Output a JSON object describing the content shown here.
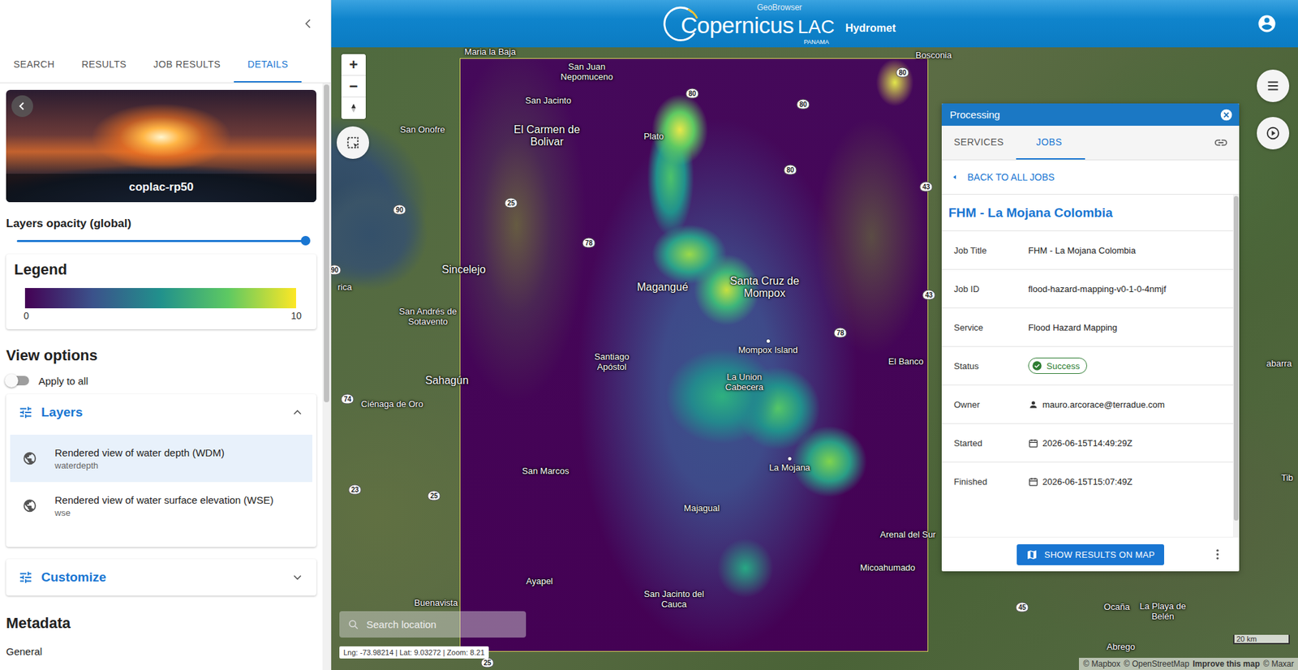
{
  "sidebar": {
    "tabs": [
      {
        "label": "SEARCH",
        "selected": false
      },
      {
        "label": "RESULTS",
        "selected": false
      },
      {
        "label": "JOB RESULTS",
        "selected": false
      },
      {
        "label": "DETAILS",
        "selected": true
      }
    ],
    "collection": {
      "title": "coplac-rp50"
    },
    "opacity": {
      "label": "Layers opacity (global)",
      "level": 1
    },
    "legend": {
      "title": "Legend",
      "min": "0",
      "max": "10"
    },
    "view_options": {
      "title": "View options",
      "apply_to_all": {
        "label": "Apply to all",
        "on": false
      }
    },
    "layers": {
      "title": "Layers",
      "expanded": true,
      "items": [
        {
          "title": "Rendered view of water depth (WDM)",
          "subtitle": "waterdepth",
          "selected": true
        },
        {
          "title": "Rendered view of water surface elevation (WSE)",
          "subtitle": "wse",
          "selected": false
        }
      ]
    },
    "customize": {
      "title": "Customize",
      "expanded": false
    },
    "metadata": {
      "title": "Metadata",
      "section": "General"
    }
  },
  "header": {
    "brand_top": "GeoBrowser",
    "brand": "Copernicus",
    "brand_suffix": "LAC",
    "brand_sub": "PANAMA",
    "app": "Hydromet"
  },
  "map": {
    "zoom_in": "+",
    "zoom_out": "−",
    "places": [
      {
        "name": "Maria la Baja",
        "kind": "town"
      },
      {
        "name": "San Juan Nepomuceno",
        "kind": "town"
      },
      {
        "name": "Bosconia",
        "kind": "town"
      },
      {
        "name": "San Jacinto",
        "kind": "town"
      },
      {
        "name": "Plato",
        "kind": "town"
      },
      {
        "name": "El Carmen de Bolivar",
        "kind": "city"
      },
      {
        "name": "San Onofre",
        "kind": "town"
      },
      {
        "name": "Sincelejo",
        "kind": "city"
      },
      {
        "name": "Magangué",
        "kind": "city"
      },
      {
        "name": "Santa Cruz de Mompox",
        "kind": "city"
      },
      {
        "name": "San Andrés de Sotavento",
        "kind": "town"
      },
      {
        "name": "Mompox Island",
        "kind": "poi"
      },
      {
        "name": "Santiago Apóstol",
        "kind": "town"
      },
      {
        "name": "El Banco",
        "kind": "town"
      },
      {
        "name": "La Union Cabecera",
        "kind": "town"
      },
      {
        "name": "Sahagún",
        "kind": "city"
      },
      {
        "name": "Ciénaga de Oro",
        "kind": "town"
      },
      {
        "name": "San Marcos",
        "kind": "town"
      },
      {
        "name": "La Mojana",
        "kind": "poi"
      },
      {
        "name": "Majagual",
        "kind": "town"
      },
      {
        "name": "Arenal del Sur",
        "kind": "town"
      },
      {
        "name": "Micoahumado",
        "kind": "town"
      },
      {
        "name": "Ayapel",
        "kind": "town"
      },
      {
        "name": "San Jacinto del Cauca",
        "kind": "town"
      },
      {
        "name": "Buenavista",
        "kind": "town"
      },
      {
        "name": "Ocaña",
        "kind": "town"
      },
      {
        "name": "La Playa de Belén",
        "kind": "town"
      },
      {
        "name": "Abrego",
        "kind": "town"
      },
      {
        "name": "rica",
        "kind": "town"
      },
      {
        "name": "abarra",
        "kind": "town"
      },
      {
        "name": "Tib",
        "kind": "town"
      }
    ],
    "shields": [
      "80",
      "80",
      "80",
      "80",
      "25",
      "90",
      "78",
      "90",
      "43",
      "43",
      "78",
      "74",
      "23",
      "25",
      "45",
      "25"
    ],
    "search_placeholder": "Search location",
    "coords": "Lng: -73.98214 | Lat: 9.03272 | Zoom: 8.21",
    "scale": "20 km",
    "attribution": [
      {
        "text": "© Mapbox",
        "bold": false
      },
      {
        "text": "© OpenStreetMap",
        "bold": false
      },
      {
        "text": "Improve this map",
        "bold": true
      },
      {
        "text": "© Maxar",
        "bold": false
      }
    ]
  },
  "processing": {
    "title": "Processing",
    "tabs": [
      {
        "label": "SERVICES",
        "selected": false
      },
      {
        "label": "JOBS",
        "selected": true
      }
    ],
    "back": "BACK TO ALL JOBS",
    "job_name": "FHM - La Mojana Colombia",
    "fields": [
      {
        "label": "Job Title",
        "value": "FHM - La Mojana Colombia",
        "kind": "text"
      },
      {
        "label": "Job ID",
        "value": "flood-hazard-mapping-v0-1-0-4nmjf",
        "kind": "text"
      },
      {
        "label": "Service",
        "value": "Flood Hazard Mapping",
        "kind": "text"
      },
      {
        "label": "Status",
        "value": "Success",
        "kind": "status"
      },
      {
        "label": "Owner",
        "value": "mauro.arcorace@terradue.com",
        "kind": "user"
      },
      {
        "label": "Started",
        "value": "2026-06-15T14:49:29Z",
        "kind": "date"
      },
      {
        "label": "Finished",
        "value": "2026-06-15T15:07:49Z",
        "kind": "date"
      }
    ],
    "action": "SHOW RESULTS ON MAP"
  }
}
